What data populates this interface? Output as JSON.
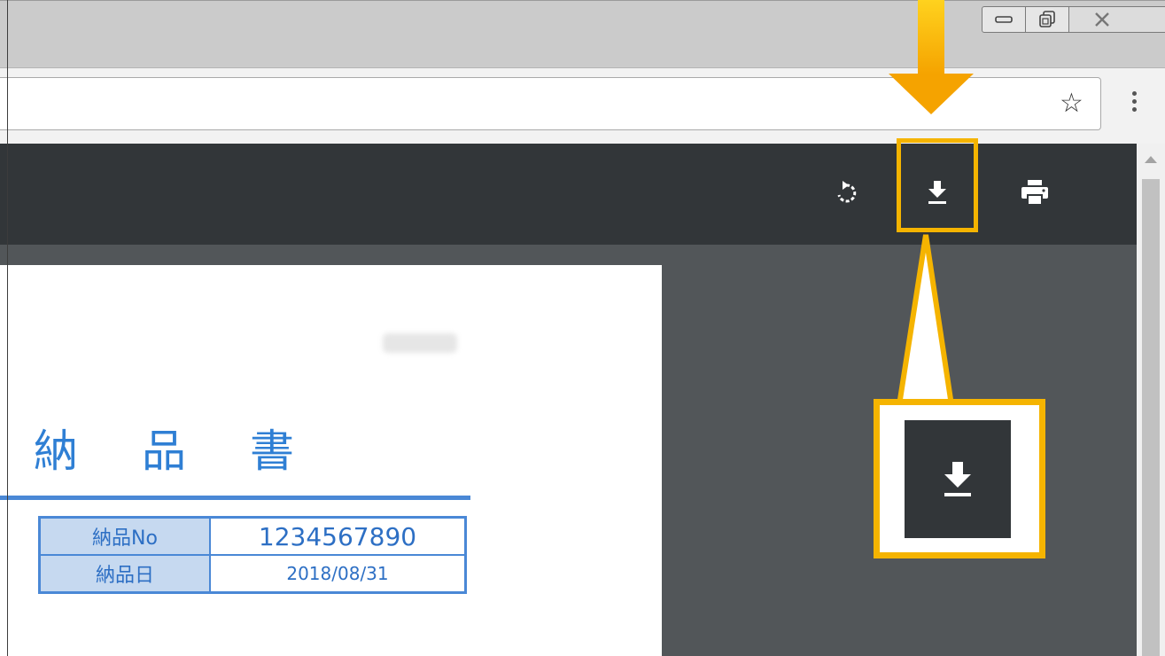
{
  "window": {
    "controls": {
      "minimize_icon": "window-minimize-icon",
      "restore_icon": "window-restore-icon",
      "close_icon": "window-close-icon"
    }
  },
  "toolbar": {
    "bookmark_icon": "star-outline-icon",
    "menu_icon": "vertical-ellipsis-icon",
    "bookmark_glyph": "☆"
  },
  "pdf_toolbar": {
    "rotate_icon": "rotate-clockwise-icon",
    "download_icon": "download-icon",
    "print_icon": "print-icon"
  },
  "document": {
    "title_chars": [
      "納",
      "品",
      "書"
    ],
    "info_table": [
      {
        "label": "納品No",
        "value": "1234567890"
      },
      {
        "label": "納品日",
        "value": "2018/08/31"
      }
    ]
  },
  "annotation": {
    "highlight_color": "#f5b400",
    "arrow_color": "#f5a300",
    "callout_icon": "download-icon"
  },
  "colors": {
    "pdf_header": "#323639",
    "viewer_bg": "#525659",
    "doc_accent": "#2f7fd4",
    "table_label_bg": "#c6d9f0"
  }
}
